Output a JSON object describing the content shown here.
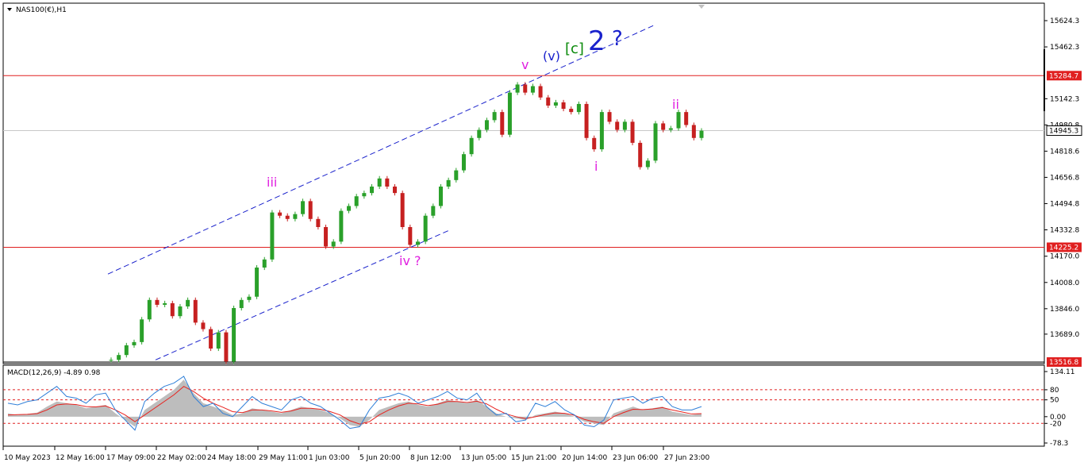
{
  "chart_data": [
    {
      "type": "line",
      "title": "NAS100(€),H1",
      "ylim": [
        13516.8,
        15624.3
      ],
      "y_ticks": [
        15624.3,
        15462.3,
        15142.3,
        14980.8,
        14818.6,
        14656.8,
        14494.8,
        14332.8,
        14170.0,
        14008.0,
        13846.0,
        13689.0
      ],
      "x_ticks": [
        "10 May 2023",
        "12 May 16:00",
        "17 May 09:00",
        "22 May 02:00",
        "24 May 18:00",
        "29 May 11:00",
        "1 Jun 03:00",
        "5 Jun 20:00",
        "8 Jun 12:00",
        "13 Jun 05:00",
        "15 Jun 21:00",
        "20 Jun 14:00",
        "23 Jun 06:00",
        "27 Jun 23:00"
      ],
      "series": [
        {
          "values": [
            13530,
            13560,
            13620,
            13640,
            13780,
            13900,
            13870,
            13880,
            13800,
            13860,
            13900,
            13760,
            13720,
            13600,
            13700,
            13520,
            13850,
            13900,
            13920,
            14100,
            14150,
            14440,
            14420,
            14400,
            14430,
            14510,
            14400,
            14350,
            14230,
            14260,
            14450,
            14480,
            14540,
            14560,
            14600,
            14650,
            14600,
            14560,
            14350,
            14240,
            14260,
            14420,
            14480,
            14600,
            14640,
            14700,
            14800,
            14900,
            14950,
            15010,
            15060,
            14920,
            15180,
            15230,
            15180,
            15220,
            15150,
            15100,
            15120,
            15080,
            15060,
            15110,
            14900,
            14830,
            15060,
            15000,
            14950,
            15000,
            14870,
            14720,
            14760,
            14990,
            14950,
            14960,
            15060,
            14980,
            14900,
            14945
          ]
        }
      ],
      "last_price": 14945.3,
      "horizontal_lines": [
        15284.7,
        14225.2,
        13516.8
      ],
      "wave_labels": [
        "v",
        "(v)",
        "[c]",
        "2",
        "?",
        "iii",
        "iv ?",
        "i",
        "ii"
      ]
    },
    {
      "type": "area",
      "title": "MACD(12,26,9) -4.89 0.98",
      "ylim": [
        -78.3,
        134.11
      ],
      "y_ticks": [
        134.11,
        80,
        50,
        0.0,
        -20,
        -78.3
      ],
      "levels": [
        80,
        50,
        0,
        -20
      ],
      "series": [
        {
          "name": "MACD",
          "values": [
            10,
            5,
            8,
            12,
            30,
            45,
            40,
            35,
            25,
            30,
            35,
            10,
            -10,
            -30,
            20,
            40,
            60,
            80,
            110,
            70,
            40,
            30,
            20,
            5,
            10,
            25,
            20,
            15,
            10,
            20,
            30,
            25,
            20,
            10,
            -5,
            -25,
            -30,
            -10,
            20,
            30,
            40,
            45,
            35,
            30,
            40,
            50,
            45,
            40,
            50,
            30,
            10,
            0,
            -5,
            -10,
            5,
            10,
            15,
            10,
            0,
            -15,
            -20,
            -25,
            10,
            20,
            30,
            20,
            25,
            30,
            15,
            10,
            5,
            10
          ],
          "color": "#bdbdbd"
        },
        {
          "name": "Signal",
          "values": [
            5,
            6,
            7,
            9,
            20,
            35,
            38,
            36,
            30,
            29,
            32,
            20,
            5,
            -15,
            5,
            25,
            45,
            65,
            90,
            75,
            55,
            40,
            28,
            15,
            12,
            20,
            20,
            17,
            13,
            17,
            25,
            25,
            22,
            15,
            5,
            -12,
            -22,
            -15,
            5,
            20,
            32,
            40,
            38,
            33,
            37,
            45,
            45,
            42,
            46,
            38,
            22,
            8,
            0,
            -6,
            0,
            6,
            11,
            10,
            4,
            -8,
            -15,
            -20,
            0,
            12,
            22,
            21,
            23,
            27,
            20,
            14,
            8,
            9
          ],
          "color": "#e8231f"
        },
        {
          "values": [
            40,
            35,
            45,
            50,
            70,
            90,
            60,
            55,
            40,
            65,
            70,
            20,
            -10,
            -40,
            45,
            70,
            90,
            100,
            120,
            60,
            30,
            40,
            10,
            0,
            30,
            60,
            40,
            30,
            20,
            50,
            60,
            40,
            30,
            10,
            -10,
            -35,
            -30,
            20,
            55,
            60,
            70,
            60,
            40,
            50,
            60,
            75,
            55,
            50,
            70,
            30,
            5,
            10,
            -15,
            -10,
            40,
            30,
            45,
            20,
            5,
            -25,
            -30,
            -10,
            50,
            55,
            60,
            40,
            55,
            60,
            30,
            20,
            20,
            30
          ],
          "color": "#2f7fd8"
        }
      ]
    }
  ]
}
